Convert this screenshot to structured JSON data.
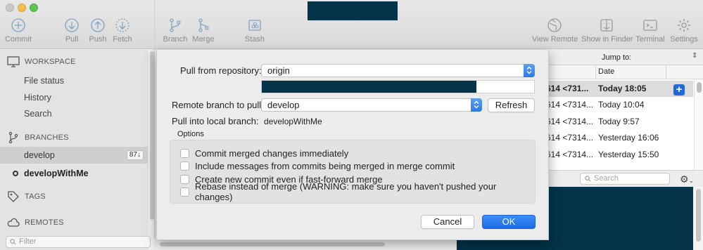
{
  "toolbar": {
    "items": [
      {
        "label": "Commit",
        "icon": "plus-circle-icon"
      },
      {
        "label": "Pull",
        "icon": "arrow-down-circle-icon"
      },
      {
        "label": "Push",
        "icon": "arrow-up-circle-icon"
      },
      {
        "label": "Fetch",
        "icon": "fetch-circle-icon"
      },
      {
        "label": "Branch",
        "icon": "branch-icon"
      },
      {
        "label": "Merge",
        "icon": "merge-icon"
      },
      {
        "label": "Stash",
        "icon": "stash-icon"
      },
      {
        "label": "View Remote",
        "icon": "globe-icon"
      },
      {
        "label": "Show in Finder",
        "icon": "finder-icon"
      },
      {
        "label": "Terminal",
        "icon": "terminal-icon"
      },
      {
        "label": "Settings",
        "icon": "gear-icon"
      }
    ]
  },
  "sidebar": {
    "workspace": "WORKSPACE",
    "workspace_items": [
      "File status",
      "History",
      "Search"
    ],
    "branches": "BRANCHES",
    "branch_items": [
      {
        "name": "develop",
        "badge": "87↓"
      },
      {
        "name": "developWithMe",
        "badge": ""
      }
    ],
    "tags": "TAGS",
    "remotes": "REMOTES",
    "filter_placeholder": "Filter"
  },
  "commits": {
    "jump_to": "Jump to:",
    "date_header": "Date",
    "rows": [
      {
        "ref": "614 <731...",
        "date": "Today 18:05"
      },
      {
        "ref": "614 <7314...",
        "date": "Today 10:04"
      },
      {
        "ref": "614 <7314...",
        "date": "Today 9:57"
      },
      {
        "ref": "614 <7314...",
        "date": "Yesterday 16:06"
      },
      {
        "ref": "614 <7314...",
        "date": "Yesterday 15:50"
      }
    ],
    "search_placeholder": "Search"
  },
  "dialog": {
    "pull_from_label": "Pull from repository:",
    "pull_from_value": "origin",
    "remote_branch_label": "Remote branch to pull:",
    "remote_branch_value": "develop",
    "refresh_label": "Refresh",
    "local_branch_label": "Pull into local branch:",
    "local_branch_value": "developWithMe",
    "options_title": "Options",
    "options": [
      "Commit merged changes immediately",
      "Include messages from commits being merged in merge commit",
      "Create new commit even if fast-forward merge",
      "Rebase instead of merge (WARNING: make sure you haven't pushed your changes)"
    ],
    "cancel_label": "Cancel",
    "ok_label": "OK"
  },
  "colors": {
    "accent": "#2f78e4",
    "redaction": "#04334a"
  }
}
